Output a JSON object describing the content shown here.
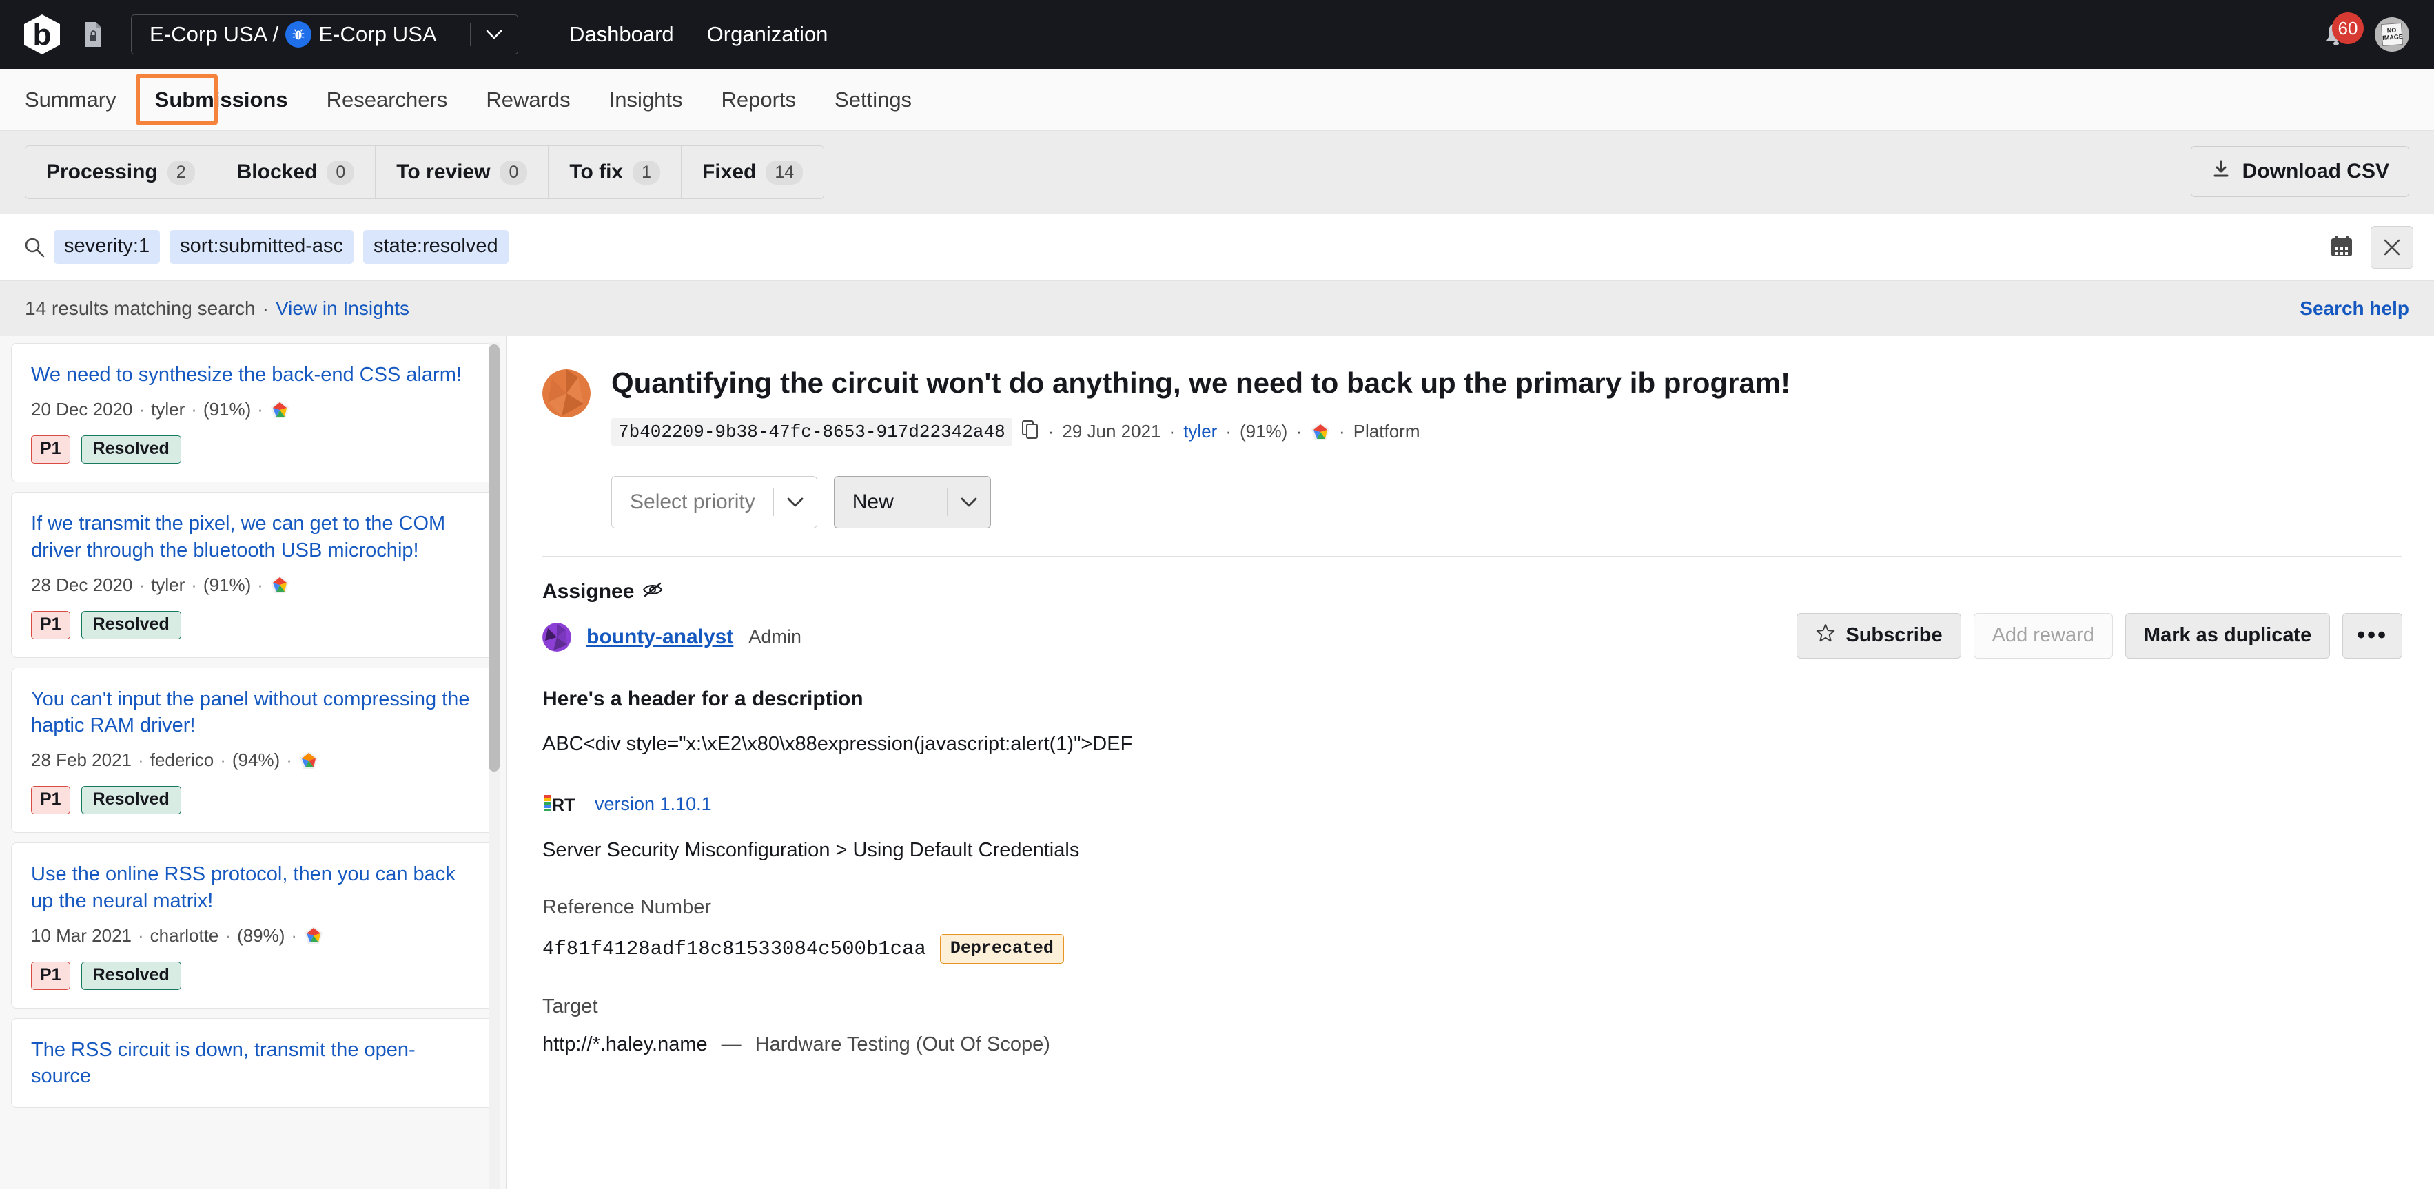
{
  "topbar": {
    "logo_icon": "bugcrowd-logo-icon",
    "doc_icon": "document-lock-icon",
    "org_path_prefix": "E-Corp USA /",
    "org_name": "E-Corp USA",
    "org_bug_icon": "bug-badge-icon",
    "caret_icon": "chevron-down-icon",
    "nav": [
      {
        "label": "Dashboard"
      },
      {
        "label": "Organization"
      }
    ],
    "bell_icon": "notification-bell-icon",
    "notification_count": "60",
    "avatar_text": "NO IMAGE"
  },
  "subnav": {
    "items": [
      {
        "label": "Summary",
        "active": false
      },
      {
        "label": "Submissions",
        "active": true
      },
      {
        "label": "Researchers",
        "active": false
      },
      {
        "label": "Rewards",
        "active": false
      },
      {
        "label": "Insights",
        "active": false
      },
      {
        "label": "Reports",
        "active": false
      },
      {
        "label": "Settings",
        "active": false
      }
    ],
    "highlight_color": "#f5833c"
  },
  "filterbar": {
    "tabs": [
      {
        "label": "Processing",
        "count": "2"
      },
      {
        "label": "Blocked",
        "count": "0"
      },
      {
        "label": "To review",
        "count": "0"
      },
      {
        "label": "To fix",
        "count": "1"
      },
      {
        "label": "Fixed",
        "count": "14"
      }
    ],
    "download_label": "Download CSV",
    "download_icon": "download-icon"
  },
  "search": {
    "icon": "search-icon",
    "chips": [
      "severity:1",
      "sort:submitted-asc",
      "state:resolved"
    ],
    "calendar_icon": "calendar-icon",
    "clear_icon": "close-icon",
    "chip_bg": "#d9e6fb"
  },
  "results": {
    "count_text": "14 results matching search",
    "separator": "·",
    "insights_link": "View in Insights",
    "search_help": "Search help"
  },
  "sidebar": {
    "items": [
      {
        "title": "We need to synthesize the back-end CSS alarm!",
        "date": "20 Dec 2020",
        "author": "tyler",
        "percent": "(91%)",
        "rank_icon": "researcher-rank-icon",
        "priority": "P1",
        "state": "Resolved"
      },
      {
        "title": "If we transmit the pixel, we can get to the COM driver through the bluetooth USB microchip!",
        "date": "28 Dec 2020",
        "author": "tyler",
        "percent": "(91%)",
        "rank_icon": "researcher-rank-icon",
        "priority": "P1",
        "state": "Resolved"
      },
      {
        "title": "You can't input the panel without compressing the haptic RAM driver!",
        "date": "28 Feb 2021",
        "author": "federico",
        "percent": "(94%)",
        "rank_icon": "researcher-rank-icon",
        "priority": "P1",
        "state": "Resolved"
      },
      {
        "title": "Use the online RSS protocol, then you can back up the neural matrix!",
        "date": "10 Mar 2021",
        "author": "charlotte",
        "percent": "(89%)",
        "rank_icon": "researcher-rank-icon",
        "priority": "P1",
        "state": "Resolved"
      },
      {
        "title": "The RSS circuit is down, transmit the open-source",
        "date": "",
        "author": "",
        "percent": "",
        "rank_icon": "researcher-rank-icon",
        "priority": "",
        "state": ""
      }
    ]
  },
  "detail": {
    "avatar_icon": "submission-avatar",
    "title": "Quantifying the circuit won't do anything, we need to back up the primary ib program!",
    "uuid": "7b402209-9b38-47fc-8653-917d22342a48",
    "copy_icon": "copy-icon",
    "date": "29 Jun 2021",
    "author": "tyler",
    "percent": "(91%)",
    "rank_icon": "researcher-rank-icon",
    "source": "Platform",
    "priority_select": {
      "value": "Select priority",
      "is_placeholder": true,
      "caret_icon": "chevron-down-icon"
    },
    "state_select": {
      "value": "New",
      "caret_icon": "chevron-down-icon"
    },
    "assignee": {
      "label": "Assignee",
      "hidden_icon": "eye-slash-icon",
      "avatar_icon": "user-avatar",
      "name": "bounty-analyst",
      "role": "Admin"
    },
    "actions": {
      "subscribe": "Subscribe",
      "subscribe_icon": "star-icon",
      "add_reward": "Add reward",
      "add_reward_disabled": true,
      "mark_duplicate": "Mark as duplicate",
      "more_label": "•••",
      "more_icon": "ellipsis-icon"
    },
    "description": {
      "header": "Here's a header for a description",
      "body": "ABC<div style=\"x:\\xE2\\x80\\x88expression(javascript:alert(1)\">DEF"
    },
    "vrt": {
      "logo_text": "VRT",
      "version_label": "version 1.10.1",
      "taxonomy": "Server Security Misconfiguration > Using Default Credentials"
    },
    "reference": {
      "label": "Reference Number",
      "value": "4f81f4128adf18c81533084c500b1caa",
      "badge": "Deprecated"
    },
    "target": {
      "label": "Target",
      "url": "http://*.haley.name",
      "dash": "—",
      "description": "Hardware Testing (Out Of Scope)"
    }
  }
}
